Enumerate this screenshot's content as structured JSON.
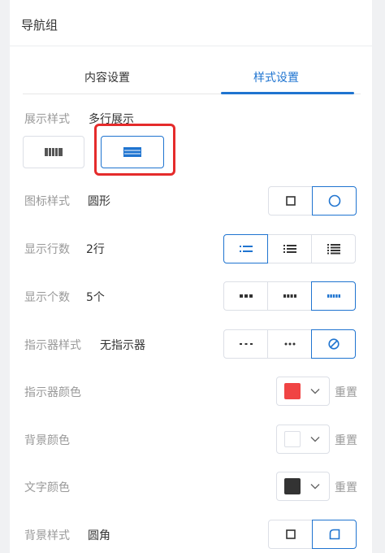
{
  "header": {
    "title": "导航组"
  },
  "tabs": [
    {
      "label": "内容设置",
      "active": false
    },
    {
      "label": "样式设置",
      "active": true
    }
  ],
  "display_style": {
    "label": "展示样式",
    "value": "多行展示"
  },
  "icon_style": {
    "label": "图标样式",
    "value": "圆形"
  },
  "row_count": {
    "label": "显示行数",
    "value": "2行"
  },
  "item_count": {
    "label": "显示个数",
    "value": "5个"
  },
  "indicator_style": {
    "label": "指示器样式",
    "value": "无指示器"
  },
  "indicator_color": {
    "label": "指示器颜色",
    "color": "#f04444",
    "reset": "重置"
  },
  "bg_color": {
    "label": "背景颜色",
    "color": "#ffffff",
    "reset": "重置"
  },
  "text_color": {
    "label": "文字颜色",
    "color": "#333333",
    "reset": "重置"
  },
  "bg_style": {
    "label": "背景样式",
    "value": "圆角"
  },
  "colors": {
    "accent": "#1f74d0",
    "highlight": "#e52b2b",
    "label": "#999999",
    "text": "#333333"
  }
}
